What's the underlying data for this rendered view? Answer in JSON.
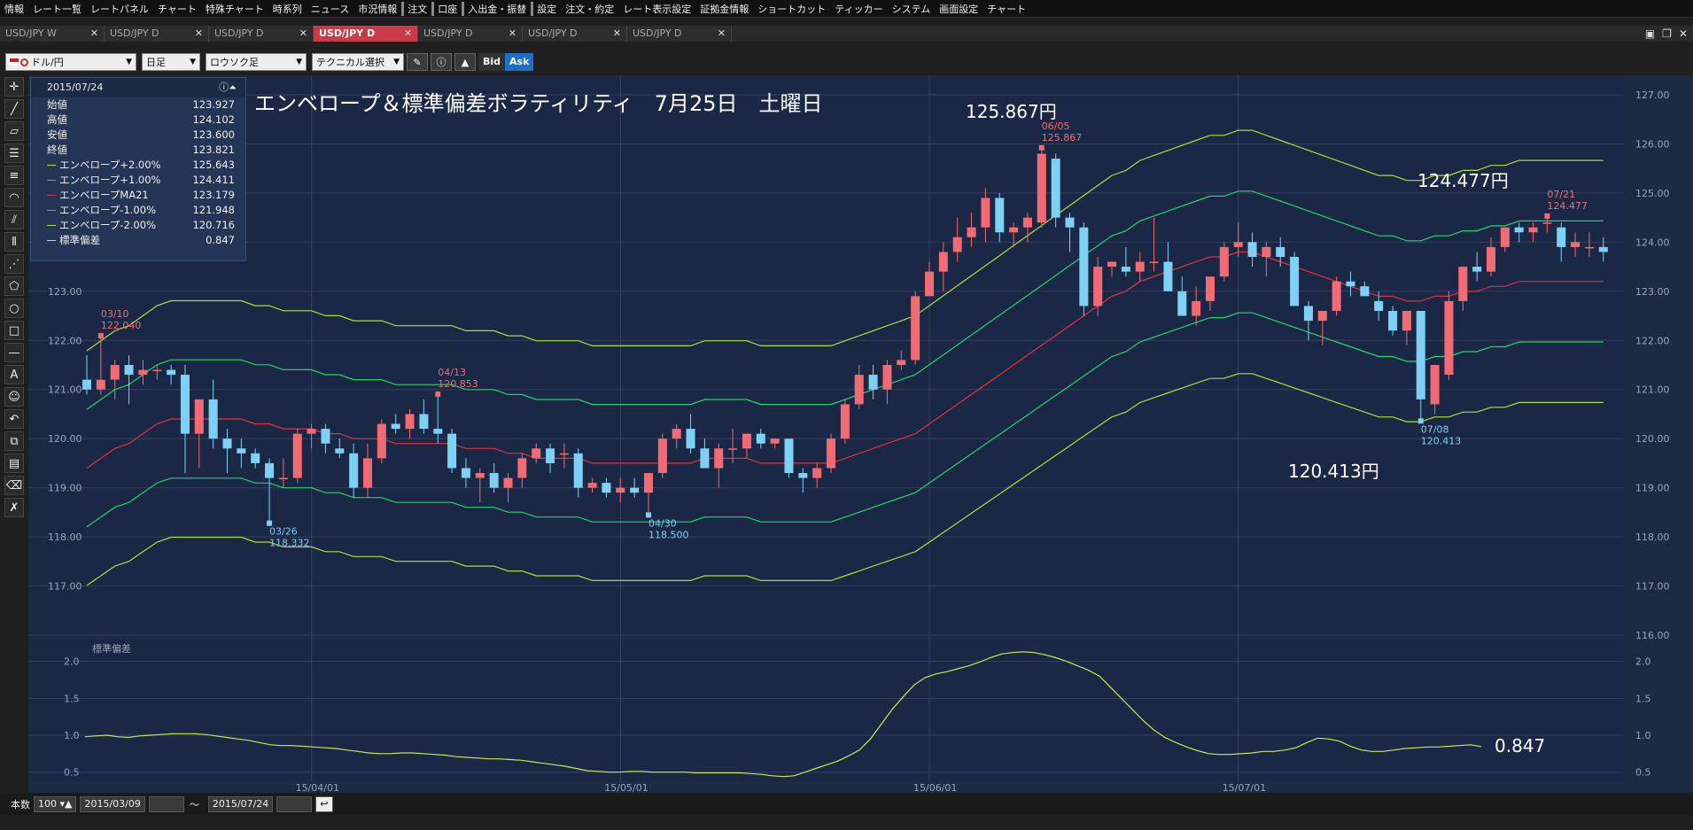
{
  "menu": [
    "情報",
    "レート一覧",
    "レートパネル",
    "チャート",
    "特殊チャート",
    "時系列",
    "ニュース",
    "市況情報",
    "注文",
    "口座",
    "入出金・振替",
    "設定",
    "注文・約定",
    "レート表示設定",
    "証拠金情報",
    "ショートカット",
    "ティッカー",
    "システム",
    "画面設定",
    "チャート"
  ],
  "tabs": [
    "USD/JPY W",
    "USD/JPY D",
    "USD/JPY D",
    "USD/JPY D",
    "USD/JPY D",
    "USD/JPY D",
    "USD/JPY D"
  ],
  "active_tab": 3,
  "toolbar": {
    "pair": "ドル/円",
    "period": "日足",
    "chart_style": "ロウソク足",
    "technical": "テクニカル選択",
    "bid": "Bid",
    "ask": "Ask"
  },
  "info": {
    "date": "2015/07/24",
    "rows": [
      {
        "label": "始値",
        "value": "123.927",
        "color": ""
      },
      {
        "label": "高値",
        "value": "124.102",
        "color": ""
      },
      {
        "label": "安値",
        "value": "123.600",
        "color": ""
      },
      {
        "label": "終値",
        "value": "123.821",
        "color": ""
      },
      {
        "label": "エンベロープ+2.00%",
        "value": "125.643",
        "color": "#a8e03a"
      },
      {
        "label": "エンベロープ+1.00%",
        "value": "124.411",
        "color": "#22d46c"
      },
      {
        "label": "エンベロープMA21",
        "value": "123.179",
        "color": "#e03040"
      },
      {
        "label": "エンベロープ-1.00%",
        "value": "121.948",
        "color": "#22d46c"
      },
      {
        "label": "エンベロープ-2.00%",
        "value": "120.716",
        "color": "#a8e03a"
      },
      {
        "label": "標準偏差",
        "value": "0.847",
        "color": "#c8e84a"
      }
    ]
  },
  "annotations": {
    "title": "エンベロープ＆標準偏差ボラティリティ　7月25日　土曜日",
    "high_big": "125.867円",
    "last_big": "124.477円",
    "low_big": "120.413円",
    "sd_big": "0.847",
    "sd_label": "標準偏差",
    "markers": [
      {
        "date": "03/10",
        "price": "122.040",
        "type": "high"
      },
      {
        "date": "03/26",
        "price": "118.332",
        "type": "low"
      },
      {
        "date": "04/13",
        "price": "120.853",
        "type": "high"
      },
      {
        "date": "04/30",
        "price": "118.500",
        "type": "low"
      },
      {
        "date": "06/05",
        "price": "125.867",
        "type": "high"
      },
      {
        "date": "07/08",
        "price": "120.413",
        "type": "low"
      },
      {
        "date": "07/21",
        "price": "124.477",
        "type": "high"
      }
    ]
  },
  "chart_data": {
    "type": "candlestick",
    "y_ticks": [
      "127.00",
      "126.00",
      "125.00",
      "124.00",
      "123.00",
      "122.00",
      "121.00",
      "120.00",
      "119.00",
      "118.00",
      "117.00",
      "116.00"
    ],
    "ylim": [
      116,
      127
    ],
    "x_ticks": [
      "15/04/01",
      "15/05/01",
      "15/06/01",
      "15/07/01"
    ],
    "sd_ticks": [
      "2.0",
      "1.5",
      "1.0",
      "0.5"
    ],
    "sd_ylim": [
      0.4,
      2.2
    ],
    "candles": [
      [
        121.2,
        121.7,
        120.9,
        121.0
      ],
      [
        121.0,
        122.04,
        120.9,
        121.2
      ],
      [
        121.2,
        121.6,
        120.8,
        121.5
      ],
      [
        121.5,
        121.7,
        120.7,
        121.3
      ],
      [
        121.3,
        121.6,
        121.1,
        121.4
      ],
      [
        121.4,
        121.5,
        121.2,
        121.4
      ],
      [
        121.4,
        121.5,
        121.1,
        121.3
      ],
      [
        121.3,
        121.5,
        119.3,
        120.1
      ],
      [
        120.1,
        120.8,
        119.4,
        120.8
      ],
      [
        120.8,
        121.2,
        119.8,
        120.0
      ],
      [
        120.0,
        120.2,
        119.3,
        119.8
      ],
      [
        119.8,
        120.0,
        119.4,
        119.7
      ],
      [
        119.7,
        119.8,
        119.4,
        119.5
      ],
      [
        119.5,
        119.6,
        118.332,
        119.2
      ],
      [
        119.2,
        119.6,
        119.0,
        119.2
      ],
      [
        119.2,
        120.2,
        119.1,
        120.1
      ],
      [
        120.1,
        120.3,
        119.8,
        120.2
      ],
      [
        120.2,
        120.3,
        119.7,
        119.9
      ],
      [
        119.8,
        120.0,
        119.6,
        119.7
      ],
      [
        119.7,
        119.9,
        118.8,
        119.0
      ],
      [
        119.0,
        119.9,
        118.8,
        119.6
      ],
      [
        119.6,
        120.4,
        119.5,
        120.3
      ],
      [
        120.3,
        120.5,
        120.1,
        120.2
      ],
      [
        120.2,
        120.6,
        120.0,
        120.5
      ],
      [
        120.5,
        120.8,
        120.1,
        120.2
      ],
      [
        120.2,
        120.853,
        119.9,
        120.1
      ],
      [
        120.1,
        120.2,
        119.3,
        119.4
      ],
      [
        119.4,
        119.6,
        119.0,
        119.2
      ],
      [
        119.2,
        119.4,
        118.7,
        119.3
      ],
      [
        119.3,
        119.5,
        118.9,
        119.0
      ],
      [
        119.0,
        119.3,
        118.7,
        119.2
      ],
      [
        119.2,
        119.7,
        119.0,
        119.6
      ],
      [
        119.6,
        119.9,
        119.5,
        119.8
      ],
      [
        119.8,
        119.9,
        119.3,
        119.5
      ],
      [
        119.7,
        119.9,
        119.4,
        119.7
      ],
      [
        119.7,
        119.8,
        118.8,
        119.0
      ],
      [
        119.0,
        119.2,
        118.9,
        119.1
      ],
      [
        119.1,
        119.2,
        118.8,
        118.9
      ],
      [
        118.9,
        119.2,
        118.7,
        119.0
      ],
      [
        119.0,
        119.2,
        118.8,
        118.9
      ],
      [
        118.9,
        119.3,
        118.5,
        119.3
      ],
      [
        119.3,
        120.1,
        119.2,
        120.0
      ],
      [
        120.0,
        120.3,
        119.8,
        120.2
      ],
      [
        120.2,
        120.5,
        119.7,
        119.8
      ],
      [
        119.8,
        120.0,
        119.5,
        119.4
      ],
      [
        119.4,
        119.9,
        119.0,
        119.8
      ],
      [
        119.8,
        120.2,
        119.5,
        119.8
      ],
      [
        119.8,
        120.1,
        119.6,
        120.1
      ],
      [
        120.1,
        120.2,
        119.8,
        119.9
      ],
      [
        119.9,
        120.0,
        119.8,
        120.0
      ],
      [
        120.0,
        120.0,
        119.2,
        119.3
      ],
      [
        119.3,
        119.4,
        118.9,
        119.2
      ],
      [
        119.2,
        119.5,
        119.0,
        119.4
      ],
      [
        119.4,
        120.1,
        119.3,
        120.0
      ],
      [
        120.0,
        120.8,
        119.9,
        120.7
      ],
      [
        120.7,
        121.5,
        120.6,
        121.3
      ],
      [
        121.3,
        121.5,
        120.8,
        121.0
      ],
      [
        121.0,
        121.6,
        120.7,
        121.5
      ],
      [
        121.5,
        121.8,
        121.4,
        121.6
      ],
      [
        121.6,
        123.0,
        121.5,
        122.9
      ],
      [
        122.9,
        123.6,
        122.9,
        123.4
      ],
      [
        123.4,
        124.0,
        123.0,
        123.8
      ],
      [
        123.8,
        124.5,
        123.6,
        124.1
      ],
      [
        124.1,
        124.6,
        123.9,
        124.3
      ],
      [
        124.3,
        125.1,
        124.0,
        124.9
      ],
      [
        124.9,
        125.0,
        124.0,
        124.2
      ],
      [
        124.2,
        124.4,
        123.9,
        124.3
      ],
      [
        124.3,
        124.6,
        124.0,
        124.5
      ],
      [
        124.4,
        125.867,
        124.3,
        125.8
      ],
      [
        125.7,
        125.8,
        124.3,
        124.5
      ],
      [
        124.5,
        124.6,
        123.8,
        124.3
      ],
      [
        124.3,
        124.4,
        122.5,
        122.7
      ],
      [
        122.7,
        123.7,
        122.5,
        123.5
      ],
      [
        123.5,
        123.6,
        123.3,
        123.6
      ],
      [
        123.5,
        123.9,
        123.3,
        123.4
      ],
      [
        123.4,
        123.8,
        123.2,
        123.6
      ],
      [
        123.6,
        124.5,
        123.4,
        123.6
      ],
      [
        123.6,
        124.0,
        123.1,
        123.0
      ],
      [
        123.0,
        123.3,
        122.5,
        122.5
      ],
      [
        122.5,
        123.1,
        122.3,
        122.8
      ],
      [
        122.8,
        123.2,
        122.6,
        123.3
      ],
      [
        123.3,
        124.0,
        123.2,
        123.9
      ],
      [
        123.9,
        124.4,
        123.7,
        124.0
      ],
      [
        124.0,
        124.2,
        123.5,
        123.7
      ],
      [
        123.7,
        124.0,
        123.3,
        123.9
      ],
      [
        123.9,
        124.1,
        123.5,
        123.7
      ],
      [
        123.7,
        123.8,
        123.0,
        122.7
      ],
      [
        122.7,
        122.8,
        122.0,
        122.4
      ],
      [
        122.4,
        122.6,
        121.9,
        122.6
      ],
      [
        122.6,
        123.3,
        122.5,
        123.2
      ],
      [
        123.2,
        123.4,
        122.9,
        123.1
      ],
      [
        123.1,
        123.2,
        122.9,
        122.9
      ],
      [
        122.8,
        123.0,
        122.4,
        122.6
      ],
      [
        122.6,
        122.7,
        122.1,
        122.2
      ],
      [
        122.2,
        122.3,
        121.9,
        122.6
      ],
      [
        122.6,
        122.6,
        120.413,
        120.8
      ],
      [
        120.7,
        121.5,
        120.5,
        121.5
      ],
      [
        121.3,
        123.0,
        121.2,
        122.8
      ],
      [
        122.8,
        123.5,
        122.6,
        123.5
      ],
      [
        123.5,
        123.8,
        123.2,
        123.4
      ],
      [
        123.4,
        124.1,
        123.3,
        123.9
      ],
      [
        123.9,
        124.3,
        123.8,
        124.3
      ],
      [
        124.3,
        124.4,
        124.0,
        124.2
      ],
      [
        124.2,
        124.4,
        124.0,
        124.3
      ],
      [
        124.4,
        124.477,
        124.2,
        124.4
      ],
      [
        124.3,
        124.4,
        123.6,
        123.9
      ],
      [
        123.9,
        124.2,
        123.7,
        124.0
      ],
      [
        123.9,
        124.2,
        123.7,
        123.9
      ],
      [
        123.9,
        124.1,
        123.6,
        123.8
      ]
    ],
    "ma21": [
      119.4,
      119.6,
      119.8,
      119.9,
      120.1,
      120.3,
      120.4,
      120.4,
      120.4,
      120.4,
      120.4,
      120.4,
      120.3,
      120.3,
      120.2,
      120.2,
      120.2,
      120.1,
      120.1,
      120.0,
      120.0,
      120.0,
      119.9,
      119.9,
      119.9,
      119.9,
      119.9,
      119.8,
      119.8,
      119.8,
      119.7,
      119.7,
      119.6,
      119.6,
      119.6,
      119.6,
      119.5,
      119.5,
      119.5,
      119.5,
      119.5,
      119.5,
      119.5,
      119.5,
      119.6,
      119.6,
      119.6,
      119.6,
      119.5,
      119.5,
      119.5,
      119.5,
      119.5,
      119.5,
      119.6,
      119.7,
      119.8,
      119.9,
      120.0,
      120.1,
      120.3,
      120.5,
      120.7,
      120.9,
      121.1,
      121.3,
      121.5,
      121.7,
      121.9,
      122.1,
      122.3,
      122.5,
      122.7,
      122.9,
      123.0,
      123.2,
      123.3,
      123.4,
      123.5,
      123.6,
      123.7,
      123.7,
      123.8,
      123.8,
      123.7,
      123.6,
      123.5,
      123.4,
      123.3,
      123.2,
      123.1,
      123.0,
      122.9,
      122.9,
      122.8,
      122.8,
      122.9,
      122.9,
      123.0,
      123.0,
      123.1,
      123.1,
      123.2,
      123.2,
      123.2,
      123.2,
      123.2,
      123.2,
      123.2
    ],
    "sd": [
      0.98,
      0.99,
      1.0,
      0.98,
      0.97,
      0.99,
      1.0,
      1.01,
      1.02,
      1.02,
      1.02,
      1.01,
      0.99,
      0.97,
      0.95,
      0.93,
      0.9,
      0.87,
      0.86,
      0.86,
      0.85,
      0.84,
      0.83,
      0.82,
      0.8,
      0.78,
      0.76,
      0.75,
      0.75,
      0.76,
      0.76,
      0.75,
      0.74,
      0.73,
      0.71,
      0.7,
      0.69,
      0.68,
      0.68,
      0.67,
      0.66,
      0.64,
      0.62,
      0.6,
      0.58,
      0.55,
      0.52,
      0.51,
      0.5,
      0.5,
      0.51,
      0.51,
      0.5,
      0.5,
      0.5,
      0.5,
      0.49,
      0.49,
      0.49,
      0.49,
      0.49,
      0.48,
      0.47,
      0.45,
      0.44,
      0.45,
      0.5,
      0.55,
      0.6,
      0.65,
      0.72,
      0.8,
      0.95,
      1.15,
      1.35,
      1.52,
      1.68,
      1.78,
      1.83,
      1.86,
      1.9,
      1.94,
      1.99,
      2.05,
      2.1,
      2.12,
      2.13,
      2.12,
      2.09,
      2.05,
      2.0,
      1.94,
      1.88,
      1.8,
      1.65,
      1.5,
      1.35,
      1.2,
      1.07,
      0.97,
      0.9,
      0.84,
      0.79,
      0.75,
      0.74,
      0.74,
      0.75,
      0.76,
      0.78,
      0.78,
      0.8,
      0.83,
      0.9,
      0.96,
      0.95,
      0.92,
      0.85,
      0.8,
      0.78,
      0.78,
      0.8,
      0.82,
      0.83,
      0.84,
      0.84,
      0.85,
      0.86,
      0.87,
      0.847
    ]
  }
}
